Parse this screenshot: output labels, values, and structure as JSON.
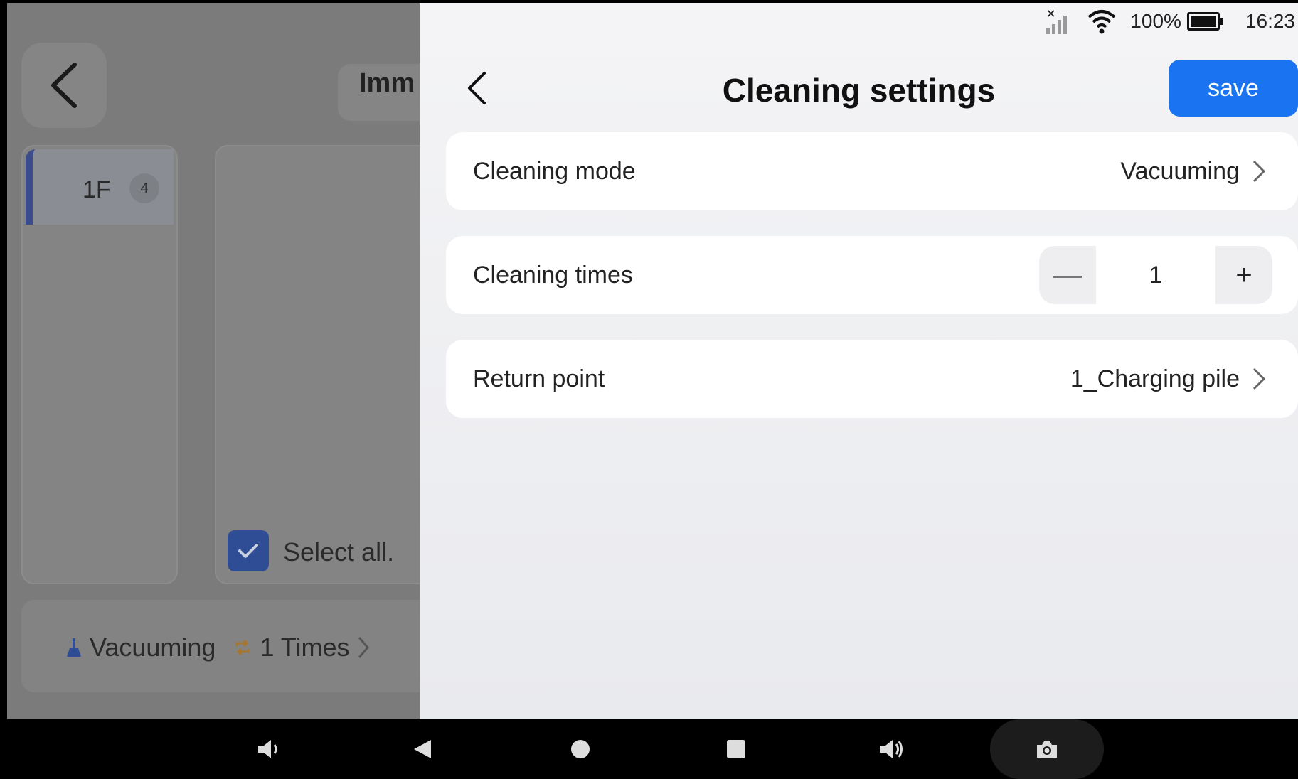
{
  "background_app": {
    "title_fragment": "Imm",
    "floor": {
      "label": "1F",
      "count": "4"
    },
    "select_all_label": "Select all.",
    "footer": {
      "mode": "Vacuuming",
      "times": "1 Times"
    }
  },
  "status_bar": {
    "battery": "100%",
    "time": "16:23"
  },
  "panel": {
    "title": "Cleaning settings",
    "save_label": "save",
    "rows": {
      "mode": {
        "label": "Cleaning mode",
        "value": "Vacuuming"
      },
      "times": {
        "label": "Cleaning times",
        "value": "1",
        "minus": "—",
        "plus": "+"
      },
      "return_point": {
        "label": "Return point",
        "value": "1_Charging pile"
      }
    }
  },
  "colors": {
    "accent": "#1a73f0",
    "overlay_dim": "#7b7b7b"
  },
  "icons": [
    "back-chevron-icon",
    "chevron-right-icon",
    "no-signal-icon",
    "wifi-icon",
    "battery-icon",
    "volume-down-icon",
    "nav-back-icon",
    "nav-home-icon",
    "nav-recents-icon",
    "volume-up-icon",
    "camera-icon",
    "broom-icon",
    "repeat-icon",
    "checkmark-icon"
  ]
}
